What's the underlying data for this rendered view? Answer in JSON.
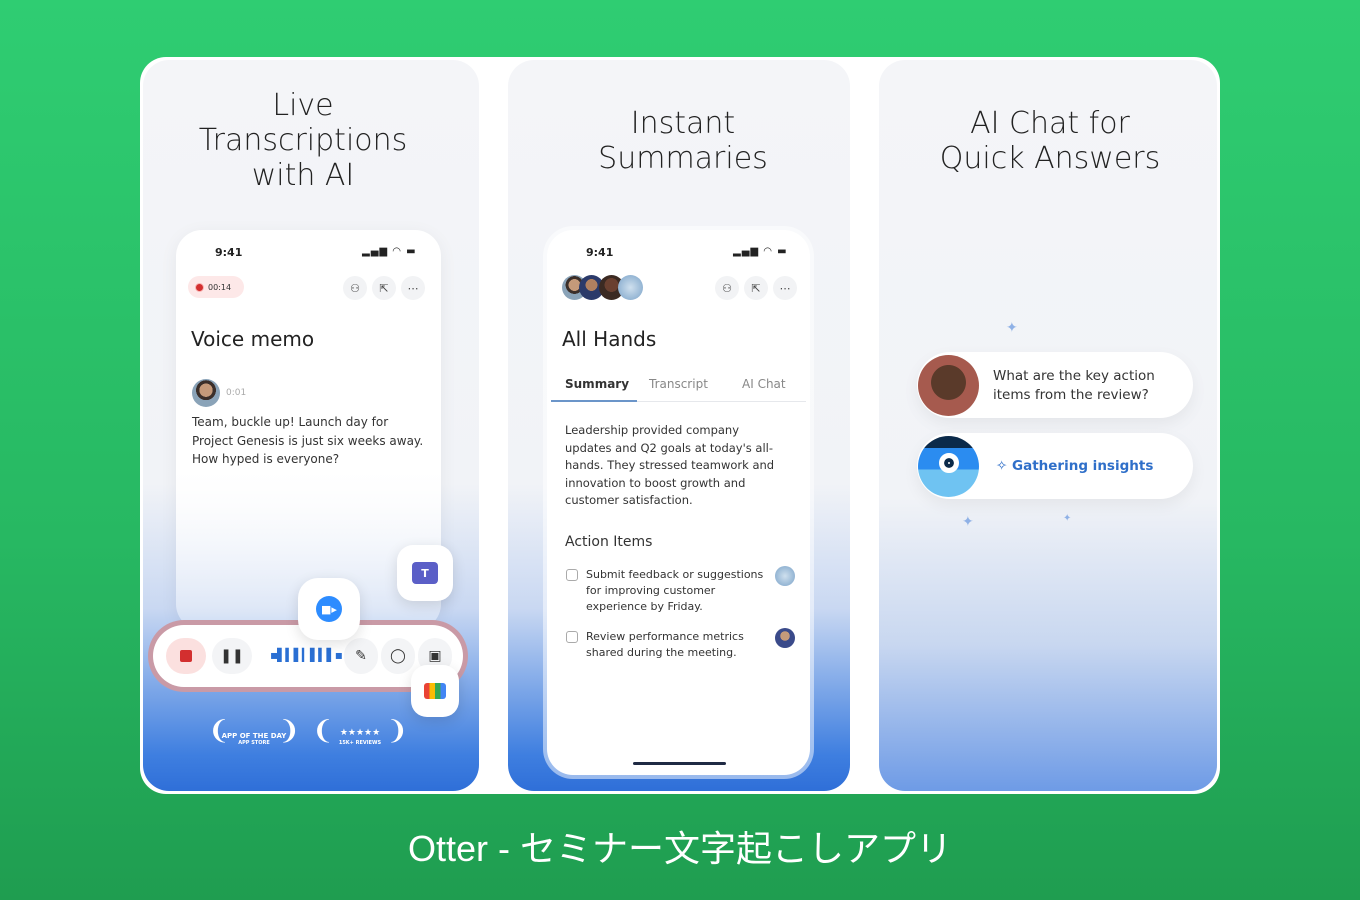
{
  "colors": {
    "background": "#2ecc71",
    "accent_blue": "#2f6fd8",
    "record_red": "#d32f2f"
  },
  "cards": [
    {
      "title_lines": [
        "Live",
        "Transcriptions",
        "with AI"
      ],
      "phone": {
        "time": "9:41",
        "recording_time": "00:14",
        "note_title": "Voice memo",
        "speaker_time": "0:01",
        "transcript": [
          "Team, buckle up! Launch day for",
          "Project Genesis is just six weeks away.",
          "How hyped is everyone?"
        ]
      },
      "toolbar_icons": [
        "stop-icon",
        "pause-icon",
        "waveform-icon",
        "highlight-icon",
        "comment-icon",
        "image-icon"
      ],
      "integrations": [
        "zoom-icon",
        "teams-icon",
        "google-meet-icon"
      ],
      "awards": [
        {
          "title": "APP OF THE DAY",
          "subtitle": "APP STORE"
        },
        {
          "title": "★★★★★",
          "subtitle": "15K+ REVIEWS"
        }
      ]
    },
    {
      "title_lines": [
        "Instant",
        "Summaries"
      ],
      "phone": {
        "time": "9:41",
        "note_title": "All Hands",
        "tabs": [
          "Summary",
          "Transcript",
          "AI Chat"
        ],
        "active_tab": "Summary",
        "summary": [
          "Leadership provided company",
          "updates and Q2 goals at today's all-",
          "hands. They stressed teamwork and",
          "innovation to boost growth and",
          "customer satisfaction."
        ],
        "action_items_title": "Action Items",
        "action_items": [
          {
            "lines": [
              "Submit feedback or suggestions",
              "for improving customer",
              "experience by Friday."
            ],
            "checked": false
          },
          {
            "lines": [
              "Review performance metrics",
              "shared during the meeting."
            ],
            "checked": false
          }
        ]
      }
    },
    {
      "title_lines": [
        "AI Chat for",
        "Quick Answers"
      ],
      "chat": {
        "question": [
          "What are the key action",
          "items from the review?"
        ],
        "status": "Gathering insights"
      }
    }
  ],
  "caption": "Otter - セミナー文字起こしアプリ"
}
